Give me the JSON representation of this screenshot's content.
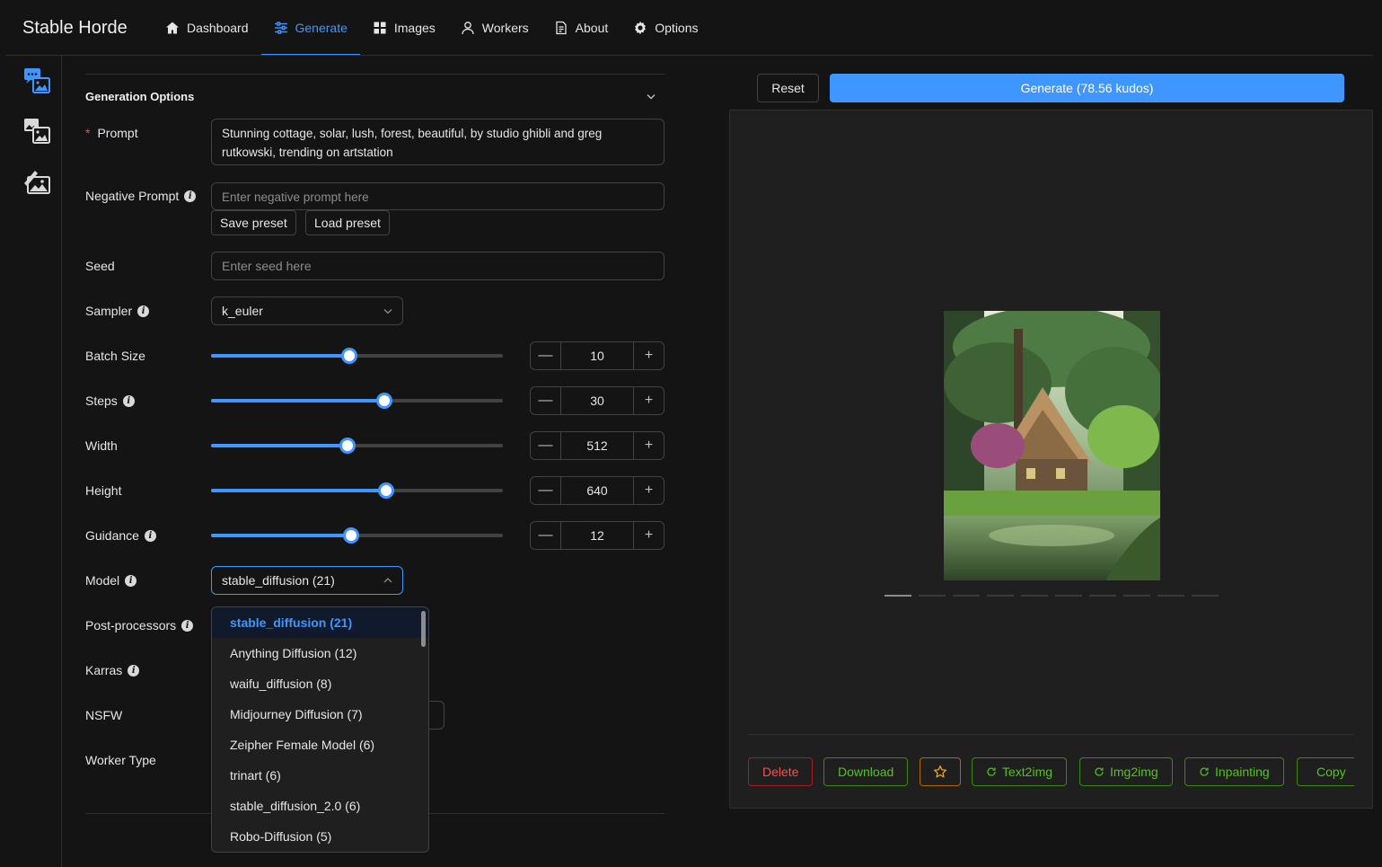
{
  "app": {
    "brand": "Stable Horde"
  },
  "nav": [
    {
      "label": "Dashboard",
      "icon": "home-icon"
    },
    {
      "label": "Generate",
      "icon": "sliders-icon",
      "active": true
    },
    {
      "label": "Images",
      "icon": "grid-icon"
    },
    {
      "label": "Workers",
      "icon": "user-icon"
    },
    {
      "label": "About",
      "icon": "document-icon"
    },
    {
      "label": "Options",
      "icon": "gear-icon"
    }
  ],
  "sidebar": {
    "items": [
      "text-to-image-icon",
      "image-to-image-icon",
      "inpainting-icon"
    ]
  },
  "form": {
    "section_title": "Generation Options",
    "prompt": {
      "label": "Prompt",
      "value": "Stunning cottage, solar, lush, forest, beautiful, by studio ghibli and greg rutkowski, trending on artstation"
    },
    "negative_prompt": {
      "label": "Negative Prompt",
      "placeholder": "Enter negative prompt here"
    },
    "save_preset": "Save preset",
    "load_preset": "Load preset",
    "seed": {
      "label": "Seed",
      "placeholder": "Enter seed here"
    },
    "sampler": {
      "label": "Sampler",
      "value": "k_euler"
    },
    "batch_size": {
      "label": "Batch Size",
      "value": "10",
      "fraction": 0.475
    },
    "steps": {
      "label": "Steps",
      "value": "30",
      "fraction": 0.595
    },
    "width": {
      "label": "Width",
      "value": "512",
      "fraction": 0.467
    },
    "height": {
      "label": "Height",
      "value": "640",
      "fraction": 0.6
    },
    "guidance": {
      "label": "Guidance",
      "value": "12",
      "fraction": 0.48
    },
    "model": {
      "label": "Model",
      "value": "stable_diffusion (21)"
    },
    "post_processors": {
      "label": "Post-processors"
    },
    "karras": {
      "label": "Karras"
    },
    "nsfw": {
      "label": "NSFW"
    },
    "worker_type": {
      "label": "Worker Type"
    },
    "model_options": [
      "stable_diffusion (21)",
      "Anything Diffusion (12)",
      "waifu_diffusion (8)",
      "Midjourney Diffusion (7)",
      "Zeipher Female Model (6)",
      "trinart (6)",
      "stable_diffusion_2.0 (6)",
      "Robo-Diffusion (5)"
    ]
  },
  "actions": {
    "reset": "Reset",
    "generate": "Generate (78.56 kudos)"
  },
  "preview": {
    "delete": "Delete",
    "download": "Download",
    "text2img": "Text2img",
    "img2img": "Img2img",
    "inpainting": "Inpainting",
    "copy": "Copy",
    "image_count": 10,
    "current_index": 1
  },
  "colors": {
    "accent": "#4096ff",
    "danger": "#ff4d4f",
    "success": "#52c41a",
    "warning": "#faad14",
    "background": "#141414"
  }
}
